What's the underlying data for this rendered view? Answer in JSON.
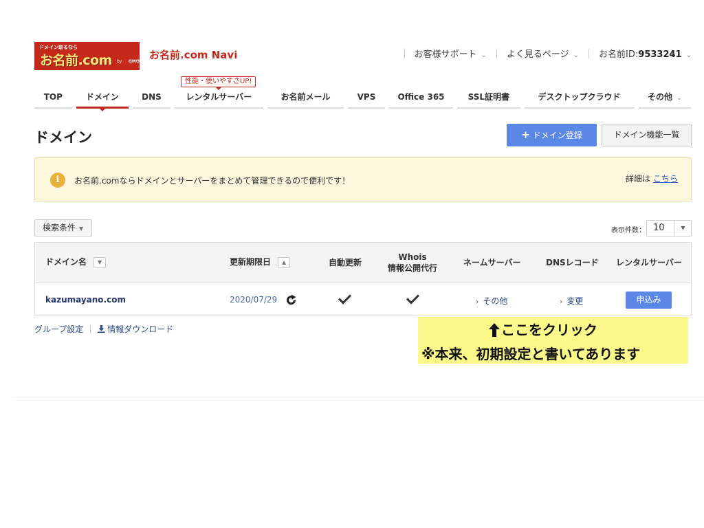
{
  "header": {
    "logo_tagline": "ドメイン取るなら",
    "logo_text": "お名前.com",
    "logo_suffix": "GMO",
    "logo_by": "by",
    "app_title": "お名前.com Navi",
    "support_link": "お客様サポート",
    "faq_link": "よく見るページ",
    "id_label": "お名前ID:",
    "id_value": "9533241"
  },
  "nav": {
    "promo": "性能・使いやすさUP!",
    "items": [
      "TOP",
      "ドメイン",
      "DNS",
      "レンタルサーバー",
      "お名前メール",
      "VPS",
      "Office 365",
      "SSL証明書",
      "デスクトップクラウド",
      "その他"
    ],
    "active": "ドメイン"
  },
  "page": {
    "title": "ドメイン",
    "register_button": "ドメイン登録",
    "features_button": "ドメイン機能一覧"
  },
  "notice": {
    "icon": "i",
    "message": "お名前.comならドメインとサーバーをまとめて管理できるので便利です！",
    "details_label": "詳細は",
    "details_link": "こちら"
  },
  "filter": {
    "search_conditions": "検索条件",
    "per_page_label": "表示件数：",
    "per_page_value": "10"
  },
  "table": {
    "headers": {
      "domain": "ドメイン名",
      "expiry": "更新期限日",
      "auto_renew": "自動更新",
      "whois_line1": "Whois",
      "whois_line2": "情報公開代行",
      "nameserver": "ネームサーバー",
      "dns_record": "DNSレコード",
      "rental_server": "レンタルサーバー"
    },
    "rows": [
      {
        "domain": "kazumayano.com",
        "expiry": "2020/07/29",
        "nameserver": "その他",
        "dns_record": "変更",
        "rental_server": "申込み"
      }
    ]
  },
  "footer": {
    "group_settings": "グループ設定",
    "download": "情報ダウンロード"
  },
  "annotation": {
    "line1": "ここをクリック",
    "line2": "※本来、初期設定と書いてあります"
  }
}
